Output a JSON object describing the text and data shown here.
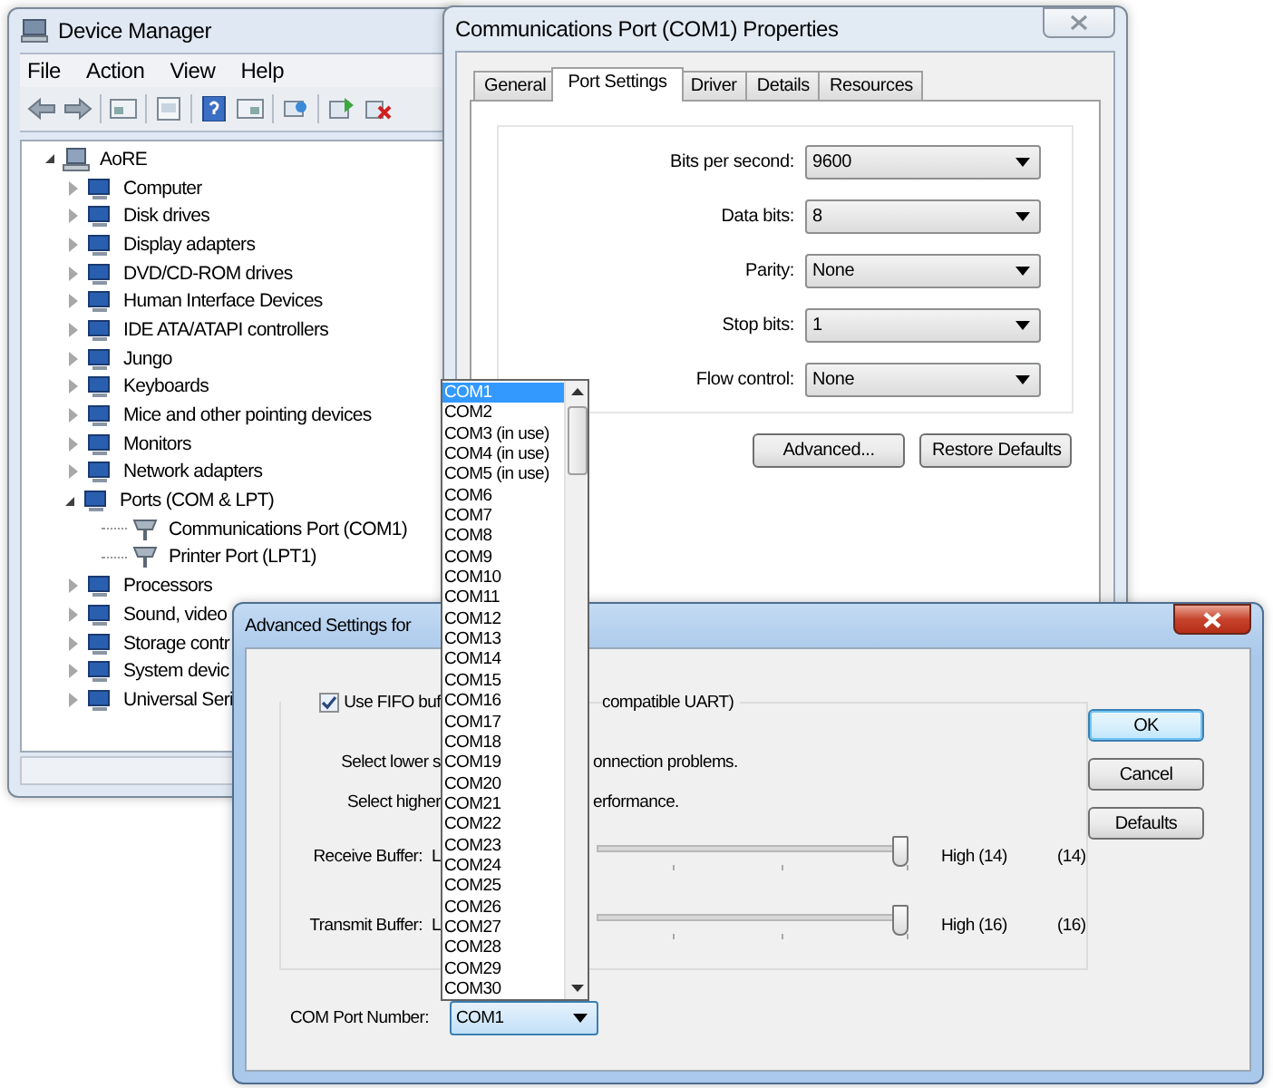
{
  "device_manager": {
    "title": "Device Manager",
    "menu": [
      "File",
      "Action",
      "View",
      "Help"
    ],
    "tree": {
      "label": "AoRE",
      "expanded": true,
      "children": [
        {
          "label": "Computer",
          "expanded": false
        },
        {
          "label": "Disk drives",
          "expanded": false
        },
        {
          "label": "Display adapters",
          "expanded": false
        },
        {
          "label": "DVD/CD-ROM drives",
          "expanded": false
        },
        {
          "label": "Human Interface Devices",
          "expanded": false
        },
        {
          "label": "IDE ATA/ATAPI controllers",
          "expanded": false
        },
        {
          "label": "Jungo",
          "expanded": false
        },
        {
          "label": "Keyboards",
          "expanded": false
        },
        {
          "label": "Mice and other pointing devices",
          "expanded": false
        },
        {
          "label": "Monitors",
          "expanded": false
        },
        {
          "label": "Network adapters",
          "expanded": false
        },
        {
          "label": "Ports (COM & LPT)",
          "expanded": true,
          "children": [
            {
              "label": "Communications Port (COM1)"
            },
            {
              "label": "Printer Port (LPT1)"
            }
          ]
        },
        {
          "label": "Processors",
          "expanded": false
        },
        {
          "label": "Sound, video",
          "expanded": false
        },
        {
          "label": "Storage contr",
          "expanded": false
        },
        {
          "label": "System devic",
          "expanded": false
        },
        {
          "label": "Universal Seri",
          "expanded": false
        }
      ]
    }
  },
  "properties": {
    "title": "Communications Port (COM1) Properties",
    "tabs": [
      {
        "label": "General",
        "selected": false
      },
      {
        "label": "Port Settings",
        "selected": true
      },
      {
        "label": "Driver",
        "selected": false
      },
      {
        "label": "Details",
        "selected": false
      },
      {
        "label": "Resources",
        "selected": false
      }
    ],
    "fields": [
      {
        "label": "Bits per second:",
        "value": "9600"
      },
      {
        "label": "Data bits:",
        "value": "8"
      },
      {
        "label": "Parity:",
        "value": "None"
      },
      {
        "label": "Stop bits:",
        "value": "1"
      },
      {
        "label": "Flow control:",
        "value": "None"
      }
    ],
    "buttons": [
      "Advanced...",
      "Restore Defaults"
    ]
  },
  "advanced": {
    "title": "Advanced Settings for",
    "fifo": {
      "label": "Use FIFO buf",
      "label_tail": "compatible UART)",
      "checked": true
    },
    "hints": [
      {
        "start": "Select lower s",
        "end": "onnection problems."
      },
      {
        "start": "Select higher",
        "end": "erformance."
      }
    ],
    "buffers": [
      {
        "label": "Receive Buffer:",
        "low": "L",
        "level": 1,
        "high": "High (14)",
        "reading": "(14)"
      },
      {
        "label": "Transmit Buffer:",
        "low": "L",
        "level": 1,
        "high": "High (16)",
        "reading": "(16)"
      }
    ],
    "com_port": {
      "label": "COM Port Number:",
      "value": "COM1"
    },
    "buttons": [
      "OK",
      "Cancel",
      "Defaults"
    ]
  },
  "com_list": [
    {
      "label": "COM1",
      "selected": true
    },
    {
      "label": "COM2",
      "selected": false
    },
    {
      "label": "COM3 (in use)",
      "selected": false
    },
    {
      "label": "COM4 (in use)",
      "selected": false
    },
    {
      "label": "COM5 (in use)",
      "selected": false
    },
    {
      "label": "COM6",
      "selected": false
    },
    {
      "label": "COM7",
      "selected": false
    },
    {
      "label": "COM8",
      "selected": false
    },
    {
      "label": "COM9",
      "selected": false
    },
    {
      "label": "COM10",
      "selected": false
    },
    {
      "label": "COM11",
      "selected": false
    },
    {
      "label": "COM12",
      "selected": false
    },
    {
      "label": "COM13",
      "selected": false
    },
    {
      "label": "COM14",
      "selected": false
    },
    {
      "label": "COM15",
      "selected": false
    },
    {
      "label": "COM16",
      "selected": false
    },
    {
      "label": "COM17",
      "selected": false
    },
    {
      "label": "COM18",
      "selected": false
    },
    {
      "label": "COM19",
      "selected": false
    },
    {
      "label": "COM20",
      "selected": false
    },
    {
      "label": "COM21",
      "selected": false
    },
    {
      "label": "COM22",
      "selected": false
    },
    {
      "label": "COM23",
      "selected": false
    },
    {
      "label": "COM24",
      "selected": false
    },
    {
      "label": "COM25",
      "selected": false
    },
    {
      "label": "COM26",
      "selected": false
    },
    {
      "label": "COM27",
      "selected": false
    },
    {
      "label": "COM28",
      "selected": false
    },
    {
      "label": "COM29",
      "selected": false
    },
    {
      "label": "COM30",
      "selected": false
    }
  ]
}
